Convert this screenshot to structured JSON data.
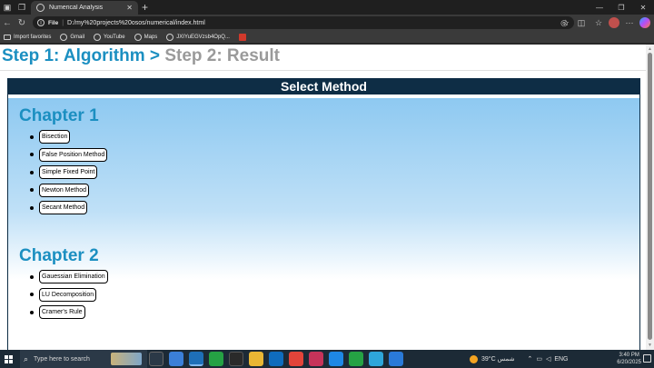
{
  "browser": {
    "tab_title": "Numerical Analysis",
    "url_scheme": "File",
    "url_path": "D:/my%20projects%20osos/numerical/index.html",
    "bookmarks": [
      {
        "label": "Import favorites",
        "icon": "folder-icon"
      },
      {
        "label": "Gmail",
        "icon": "globe-icon"
      },
      {
        "label": "YouTube",
        "icon": "globe-icon"
      },
      {
        "label": "Maps",
        "icon": "globe-icon"
      },
      {
        "label": "JXIYuEGVzsb4OpQ...",
        "icon": "globe-icon"
      },
      {
        "label": "",
        "icon": "pdf-icon"
      }
    ]
  },
  "page": {
    "step1": "Step 1: Algorithm",
    "arrow": ">",
    "step2": "Step 2: Result",
    "panel_title": "Select Method",
    "chapters": [
      {
        "title": "Chapter 1",
        "methods": [
          "Bisection",
          "False Position Method",
          "Simple Fixed Point",
          "Newton Method",
          "Secant Method"
        ]
      },
      {
        "title": "Chapter 2",
        "methods": [
          "Gauessian Elimination",
          "LU Decomposition",
          "Cramer's Rule"
        ]
      }
    ]
  },
  "taskbar": {
    "search_placeholder": "Type here to search",
    "weather": "39°C  شمس",
    "language": "ENG",
    "time": "3:40 PM",
    "date": "6/20/2025"
  },
  "colors": {
    "accent": "#1b8fc1",
    "header_bg": "#0e2d45",
    "inactive_step": "#9a9a9a"
  }
}
